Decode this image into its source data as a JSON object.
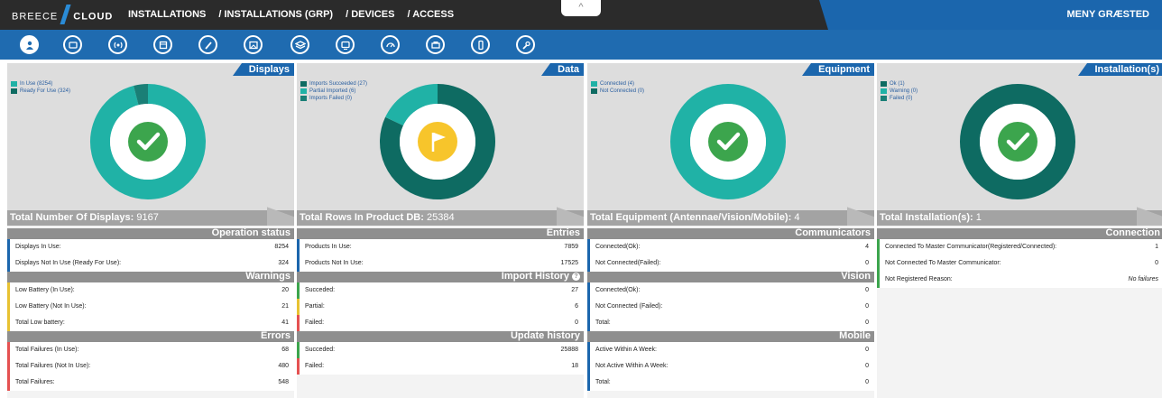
{
  "header": {
    "brand_left": "BREECE",
    "brand_right": "CLOUD",
    "nav": [
      "INSTALLATIONS",
      "/ INSTALLATIONS (GRP)",
      "/ DEVICES",
      "/ ACCESS"
    ],
    "collapse_glyph": "^",
    "user": "MENY GRÆSTED"
  },
  "icons": [
    "user-badge-icon",
    "display-tag-icon",
    "antenna-icon",
    "package-icon",
    "brush-icon",
    "image-icon",
    "layers-icon",
    "monitor-icon",
    "gauge-icon",
    "printer-icon",
    "phone-icon",
    "wrench-icon"
  ],
  "colors": {
    "teal": "#20b2a6",
    "dark_teal": "#0e6b62",
    "blue": "#1b66ad",
    "green": "#3ca54d",
    "yellow": "#f7c52b",
    "red": "#e55151"
  },
  "panels": [
    {
      "title": "Displays",
      "legend": [
        {
          "label": "In Use (8254)",
          "color": "#20b2a6"
        },
        {
          "label": "Ready For Use (324)",
          "color": "#0e6b62"
        }
      ],
      "chart_data": {
        "type": "pie",
        "categories": [
          "In Use",
          "Ready For Use"
        ],
        "values": [
          8254,
          324
        ]
      },
      "status_icon": "check-icon",
      "total_label": "Total Number Of Displays:",
      "total_value": "9167",
      "sections": [
        {
          "title": "Operation status",
          "rows": [
            {
              "label": "Displays In Use:",
              "value": "8254",
              "color": "blue"
            },
            {
              "label": "Displays Not In Use (Ready For Use):",
              "value": "324",
              "color": "blue"
            }
          ]
        },
        {
          "title": "Warnings",
          "rows": [
            {
              "label": "Low Battery (In Use):",
              "value": "20",
              "color": "yellow"
            },
            {
              "label": "Low Battery (Not In Use):",
              "value": "21",
              "color": "yellow"
            },
            {
              "label": "Total Low battery:",
              "value": "41",
              "color": "yellow"
            }
          ]
        },
        {
          "title": "Errors",
          "rows": [
            {
              "label": "Total Failures (In Use):",
              "value": "68",
              "color": "red"
            },
            {
              "label": "Total Failures (Not In Use):",
              "value": "480",
              "color": "red"
            },
            {
              "label": "Total Failures:",
              "value": "548",
              "color": "red"
            }
          ]
        }
      ]
    },
    {
      "title": "Data",
      "legend": [
        {
          "label": "Imports Succeeded (27)",
          "color": "#0e6b62"
        },
        {
          "label": "Partial Imported (6)",
          "color": "#20b2a6"
        },
        {
          "label": "Imports Failed (0)",
          "color": "#1a7f76"
        }
      ],
      "chart_data": {
        "type": "pie",
        "categories": [
          "Imports Succeeded",
          "Partial Imported",
          "Imports Failed"
        ],
        "values": [
          27,
          6,
          0
        ]
      },
      "status_icon": "flag-icon",
      "total_label": "Total Rows In Product DB:",
      "total_value": "25384",
      "sections": [
        {
          "title": "Entries",
          "rows": [
            {
              "label": "Products In Use:",
              "value": "7859",
              "color": "blue"
            },
            {
              "label": "Products Not In Use:",
              "value": "17525",
              "color": "blue"
            }
          ]
        },
        {
          "title": "Import History",
          "rows": [
            {
              "label": "Succeded:",
              "value": "27",
              "color": "green"
            },
            {
              "label": "Partial:",
              "value": "6",
              "color": "yellow"
            },
            {
              "label": "Failed:",
              "value": "0",
              "color": "red"
            }
          ]
        },
        {
          "title": "Update history",
          "rows": [
            {
              "label": "Succeded:",
              "value": "25888",
              "color": "green"
            },
            {
              "label": "Failed:",
              "value": "18",
              "color": "red"
            }
          ]
        }
      ]
    },
    {
      "title": "Equipment",
      "legend": [
        {
          "label": "Connected (4)",
          "color": "#20b2a6"
        },
        {
          "label": "Not Connected (0)",
          "color": "#0e6b62"
        }
      ],
      "chart_data": {
        "type": "pie",
        "categories": [
          "Connected",
          "Not Connected"
        ],
        "values": [
          4,
          0
        ]
      },
      "status_icon": "check-icon",
      "total_label": "Total Equipment (Antennae/Vision/Mobile):",
      "total_value": "4",
      "sections": [
        {
          "title": "Communicators",
          "rows": [
            {
              "label": "Connected(Ok):",
              "value": "4",
              "color": "blue"
            },
            {
              "label": "Not Connected(Failed):",
              "value": "0",
              "color": "blue"
            }
          ]
        },
        {
          "title": "Vision",
          "rows": [
            {
              "label": "Connected(Ok):",
              "value": "0",
              "color": "blue"
            },
            {
              "label": "Not Connected (Failed):",
              "value": "0",
              "color": "blue"
            },
            {
              "label": "Total:",
              "value": "0",
              "color": "blue"
            }
          ]
        },
        {
          "title": "Mobile",
          "rows": [
            {
              "label": "Active Within A Week:",
              "value": "0",
              "color": "blue"
            },
            {
              "label": "Not Active Within A Week:",
              "value": "0",
              "color": "blue"
            },
            {
              "label": "Total:",
              "value": "0",
              "color": "blue"
            }
          ]
        }
      ]
    },
    {
      "title": "Installation(s)",
      "legend": [
        {
          "label": "Ok (1)",
          "color": "#0e6b62"
        },
        {
          "label": "Warning (0)",
          "color": "#20b2a6"
        },
        {
          "label": "Failed (0)",
          "color": "#1a7f76"
        }
      ],
      "chart_data": {
        "type": "pie",
        "categories": [
          "Ok",
          "Warning",
          "Failed"
        ],
        "values": [
          1,
          0,
          0
        ]
      },
      "status_icon": "check-icon",
      "total_label": "Total Installation(s):",
      "total_value": "1",
      "sections": [
        {
          "title": "Connection",
          "rows": [
            {
              "label": "Connected To Master Communicator(Registered/Connected):",
              "value": "1",
              "color": "green"
            },
            {
              "label": "Not Connected To Master Communicator:",
              "value": "0",
              "color": "green"
            },
            {
              "label": "Not Registered Reason:",
              "value": "No failures",
              "color": "green",
              "italic": true
            }
          ]
        }
      ]
    }
  ]
}
